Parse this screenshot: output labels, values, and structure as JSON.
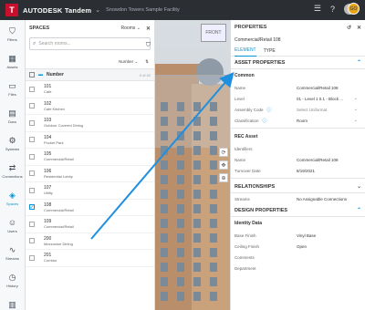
{
  "app": {
    "logo_letter": "T",
    "brand": "AUTODESK Tandem",
    "facility": "Snowdon Towers Sample Facility",
    "avatar_initials": "GO"
  },
  "nav": [
    {
      "label": "Filters",
      "icon": "filter-icon",
      "glyph": "⛉"
    },
    {
      "label": "Assets",
      "icon": "assets-icon",
      "glyph": "▦"
    },
    {
      "label": "Files",
      "icon": "folder-icon",
      "glyph": "▭"
    },
    {
      "label": "Docs",
      "icon": "document-icon",
      "glyph": "▤"
    },
    {
      "label": "Systems",
      "icon": "systems-icon",
      "glyph": "⚙"
    },
    {
      "label": "Connections",
      "icon": "connections-icon",
      "glyph": "⇄"
    },
    {
      "label": "Spaces",
      "icon": "spaces-icon",
      "glyph": "◈"
    },
    {
      "label": "Users",
      "icon": "users-icon",
      "glyph": "☺"
    },
    {
      "label": "Streams",
      "icon": "streams-icon",
      "glyph": "∿"
    },
    {
      "label": "History",
      "icon": "history-icon",
      "glyph": "◷"
    },
    {
      "label": "Inventory",
      "icon": "inventory-icon",
      "glyph": "▥"
    }
  ],
  "spaces": {
    "title": "SPACES",
    "mode": "Rooms",
    "search_placeholder": "Search rooms...",
    "sort_label": "Number",
    "column_header": "Number",
    "count": "0 of 42",
    "rooms": [
      {
        "number": "101",
        "name": "Café",
        "checked": false
      },
      {
        "number": "102",
        "name": "Cafe Kitchen",
        "checked": false
      },
      {
        "number": "103",
        "name": "Outdoor Covered Dining",
        "checked": false
      },
      {
        "number": "104",
        "name": "Pocket Park",
        "checked": false
      },
      {
        "number": "105",
        "name": "Commercial/Retail",
        "checked": false
      },
      {
        "number": "106",
        "name": "Residential Lobby",
        "checked": false
      },
      {
        "number": "107",
        "name": "Utility",
        "checked": false
      },
      {
        "number": "108",
        "name": "Commercial/Retail",
        "checked": true
      },
      {
        "number": "109",
        "name": "Commercial/Retail",
        "checked": false
      },
      {
        "number": "200",
        "name": "Mezzanine Dining",
        "checked": false
      },
      {
        "number": "201",
        "name": "Corridor",
        "checked": false
      }
    ]
  },
  "viewer": {
    "viewcube_label": "FRONT"
  },
  "properties": {
    "title": "PROPERTIES",
    "subtitle": "Commercial/Retail 108",
    "tabs": [
      "ELEMENT",
      "TYPE"
    ],
    "asset_section": "ASSET PROPERTIES",
    "common_group": "Common",
    "common_rows": [
      {
        "key": "Name",
        "value": "Commercial/Retail 108",
        "info": false,
        "dropdown": false
      },
      {
        "key": "Level",
        "value": "01 - Level 1 0.1 - Block ...",
        "info": false,
        "dropdown": true
      },
      {
        "key": "Assembly Code",
        "value": "Select Uniformat",
        "info": true,
        "dropdown": true
      },
      {
        "key": "Classification",
        "value": "Room",
        "info": true,
        "dropdown": true
      }
    ],
    "rec_group": "REC Asset",
    "rec_rows": [
      {
        "key": "Identifiers",
        "value": ""
      },
      {
        "key": "Name",
        "value": "Commercial/Retail 108"
      },
      {
        "key": "Turnover Date",
        "value": "8/19/2021"
      }
    ],
    "relationships_section": "RELATIONSHIPS",
    "streams_key": "Streams",
    "streams_value": "No Assignable Connections",
    "design_section": "DESIGN PROPERTIES",
    "identity_group": "Identity Data",
    "identity_rows": [
      {
        "key": "Base Finish",
        "value": "Vinyl Base"
      },
      {
        "key": "Ceiling Finish",
        "value": "Open"
      },
      {
        "key": "Comments",
        "value": ""
      },
      {
        "key": "Department",
        "value": ""
      }
    ]
  },
  "colors": {
    "accent": "#0696d7",
    "topbar": "#2b2f33",
    "arrow": "#1f8fe0"
  }
}
